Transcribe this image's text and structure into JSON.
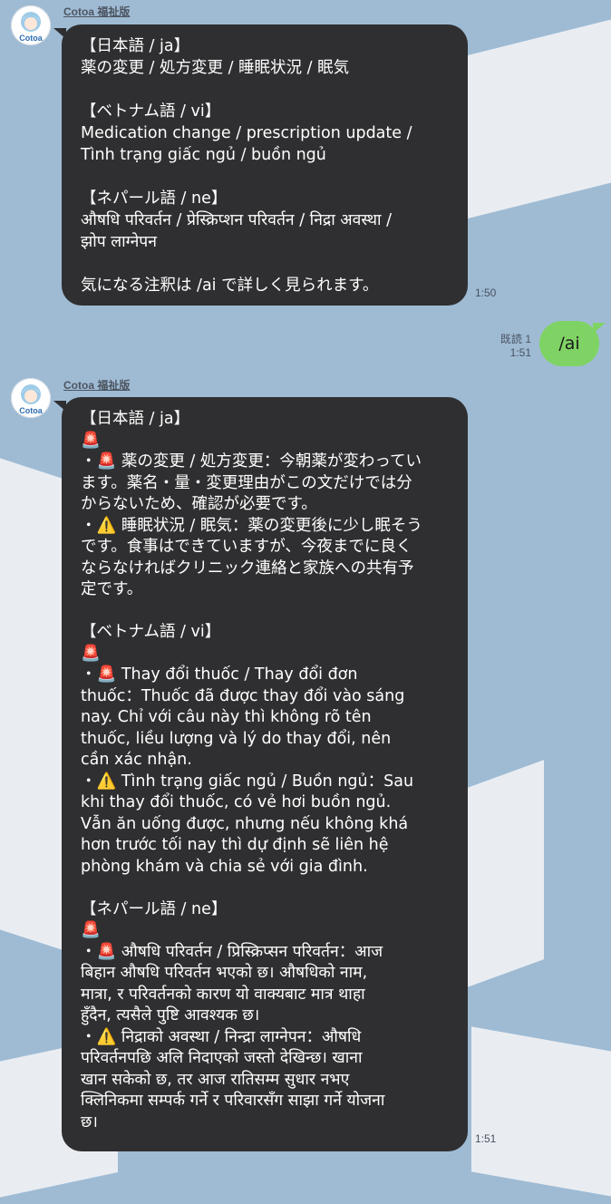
{
  "chat": {
    "messages": [
      {
        "sender": "Cotoa 福祉版",
        "time": "1:50",
        "lines": [
          "【日本語 / ja】",
          "薬の変更 / 処方変更 / 睡眠状況 / 眠気",
          "",
          "【ベトナム語 / vi】",
          "Medication change / prescription update /",
          "Tình trạng giấc ngủ / buồn ngủ",
          "",
          "【ネパール語 / ne】",
          "औषधि परिवर्तन / प्रेस्क्रिप्शन परिवर्तन / निद्रा अवस्था /",
          "झोप लाग्नेपन",
          "",
          "気になる注釈は /ai で詳しく見られます。"
        ]
      },
      {
        "sender": "Cotoa 福祉版",
        "time": "1:51",
        "lines": [
          "【日本語 / ja】",
          "🚨",
          "・🚨 薬の変更 / 処方変更：今朝薬が変わってい",
          "ます。薬名・量・変更理由がこの文だけでは分",
          "からないため、確認が必要です。",
          "・⚠️ 睡眠状況 / 眠気：薬の変更後に少し眠そう",
          "です。食事はできていますが、今夜までに良く",
          "ならなければクリニック連絡と家族への共有予",
          "定です。",
          "",
          "【ベトナム語 / vi】",
          "🚨",
          "・🚨 Thay đổi thuốc / Thay đổi đơn",
          "thuốc：Thuốc đã được thay đổi vào sáng",
          "nay. Chỉ với câu này thì không rõ tên",
          "thuốc, liều lượng và lý do thay đổi, nên",
          "cần xác nhận.",
          "・⚠️ Tình trạng giấc ngủ / Buồn ngủ：Sau",
          "khi thay đổi thuốc, có vẻ hơi buồn ngủ.",
          "Vẫn ăn uống được, nhưng nếu không khá",
          "hơn trước tối nay thì dự định sẽ liên hệ",
          "phòng khám và chia sẻ với gia đình.",
          "",
          "【ネパール語 / ne】",
          "🚨",
          "・🚨 औषधि परिवर्तन / प्रिस्क्रिप्सन परिवर्तन：आज",
          "बिहान औषधि परिवर्तन भएको छ। औषधिको नाम,",
          "मात्रा, र परिवर्तनको कारण यो वाक्यबाट मात्र थाहा",
          "हुँदैन, त्यसैले पुष्टि आवश्यक छ।",
          "・⚠️ निद्राको अवस्था / निन्द्रा लाग्नेपन：औषधि",
          "परिवर्तनपछि अलि निदाएको जस्तो देखिन्छ। खाना",
          "खान सकेको छ, तर आज रातिसम्म सुधार नभए",
          "क्लिनिकमा सम्पर्क गर्ने र परिवारसँग साझा गर्ने योजना",
          "छ।"
        ]
      }
    ],
    "my_message": {
      "text": "/ai",
      "read": "既読 1",
      "time": "1:51"
    }
  },
  "avatar_label": "Cotoa",
  "colors": {
    "background": "#9fbbd4",
    "bubble_dark": "#2f2f31",
    "bubble_me": "#7fd365"
  }
}
